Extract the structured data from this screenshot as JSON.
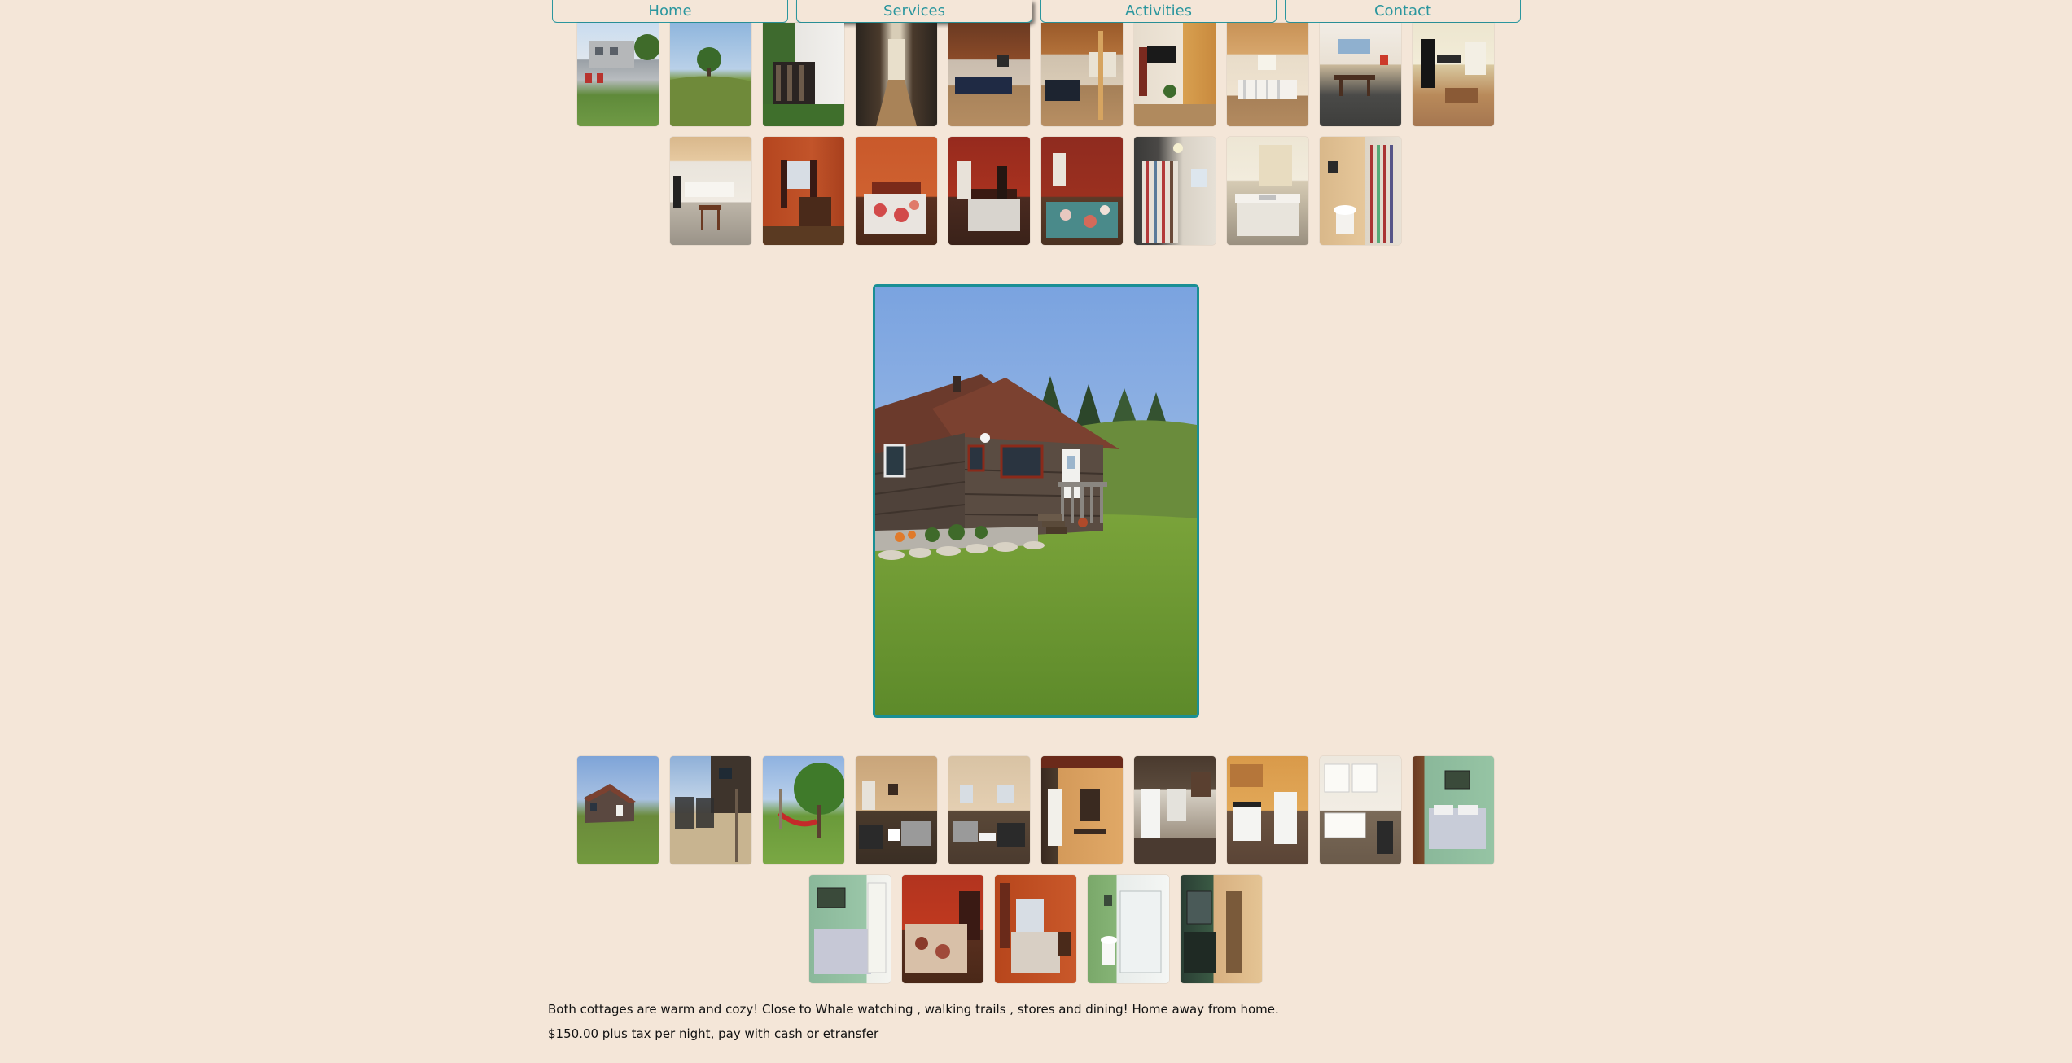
{
  "nav": {
    "home": "Home",
    "services": "Services",
    "activities": "Activities",
    "contact": "Contact",
    "accent_color": "#2a969e"
  },
  "page": {
    "background": "#f4e6d8",
    "description": "Both cottages are warm and cozy! Close to Whale watching , walking trails , stores and dining! Home away from home.",
    "price": "$150.00 plus tax per night, pay with cash or etransfer"
  },
  "gallery_top": {
    "row1": [
      "exterior-yard",
      "field-tree",
      "gate-porch",
      "hallway",
      "living-room",
      "living-room-2",
      "tv-room",
      "dining-stairs",
      "dining-room",
      "kitchen"
    ],
    "row2": [
      "kitchen-dining",
      "bedroom-orange",
      "bedroom-bed",
      "bedroom-red",
      "bedroom-quilt",
      "bathroom-curtain",
      "bathroom-vanity",
      "bathroom-toilet"
    ]
  },
  "main_photo": {
    "subject": "shingled-cottage-exterior"
  },
  "gallery_bottom": {
    "row1": [
      "cottage-exterior",
      "deck-chairs",
      "yard-hammock",
      "living-room",
      "living-room-2",
      "kitchen-hall",
      "kitchen-fridge",
      "kitchen-stove",
      "kitchen-white",
      "bedroom-green"
    ],
    "row2": [
      "bedroom-green-2",
      "bedroom-red",
      "bedroom-orange",
      "bathroom-shower",
      "bathroom-vanity"
    ]
  }
}
